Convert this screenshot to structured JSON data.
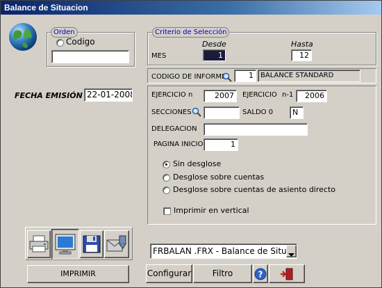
{
  "window": {
    "title": "Balance de Situacion"
  },
  "orden": {
    "title": "Orden",
    "option_label": "Codigo",
    "value": ""
  },
  "fecha": {
    "label": "FECHA EMISIÓN",
    "value": "22-01-2008"
  },
  "criterio": {
    "title": "Criterio de Selección",
    "desde_label": "Desde",
    "hasta_label": "Hasta",
    "mes_label": "MES",
    "mes_desde": "1",
    "mes_hasta": "12"
  },
  "informe": {
    "label": "CODIGO DE INFORME",
    "code": "1",
    "name": "BALANCE STANDARD"
  },
  "ejercicio": {
    "label_n": "EJERCICIO n",
    "value_n": "2007",
    "label_n1": "EJERCICIO",
    "suffix_n1": "n-1",
    "value_n1": "2006"
  },
  "secciones": {
    "label": "SECCIONES",
    "value": ""
  },
  "saldo": {
    "label": "SALDO 0",
    "value": "N"
  },
  "delegacion": {
    "label": "DELEGACION",
    "value": ""
  },
  "pagina": {
    "label": "PAGINA INICIO",
    "value": "1"
  },
  "options": {
    "sin": "Sin desglose",
    "cuentas": "Desglose sobre cuentas",
    "asiento": "Desglose sobre cuentas de asiento directo",
    "vertical": "Imprimir en vertical"
  },
  "report_select": {
    "value": "FRBALAN .FRX - Balance de Situaci"
  },
  "buttons": {
    "imprimir": "IMPRIMIR",
    "configurar": "Configurar",
    "filtro": "Filtro"
  },
  "colors": {
    "title_bar": "#0a246a",
    "group_title": "#0000c0",
    "face": "#d4d0c8"
  }
}
